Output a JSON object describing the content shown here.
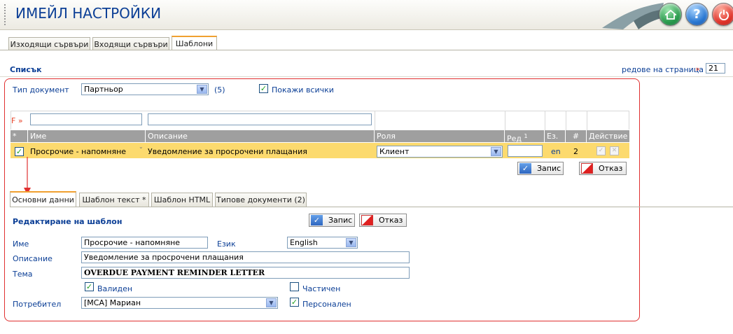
{
  "header": {
    "title": "ИМЕЙЛ НАСТРОЙКИ"
  },
  "top_tabs": [
    "Изходящи сървъри",
    "Входящи сървъри",
    "Шаблони"
  ],
  "list": {
    "title": "Списък",
    "rows_per_page_label": "редове на страница",
    "rows_arrow": "»",
    "rows_per_page": "21"
  },
  "filter": {
    "doc_type_label": "Тип документ",
    "doc_type_value": "Партньор",
    "count": "(5)",
    "show_all_label": "Покажи всички",
    "filter_marker": "F »"
  },
  "grid": {
    "headers": [
      "*",
      "Име",
      "Описание",
      "Роля",
      "Ред",
      "1",
      "Ез.",
      "#",
      "Действие"
    ],
    "row": {
      "name": "Просрочие - напомняне",
      "description": "Уведомление за просрочени плащания",
      "role": "Клиент",
      "order": "",
      "lang": "en",
      "num": "2"
    },
    "save_label": "Запис",
    "cancel_label": "Отказ"
  },
  "sub_tabs": [
    "Основни данни",
    "Шаблон текст *",
    "Шаблон HTML",
    "Типове документи (2)"
  ],
  "edit": {
    "title": "Редактиране на шаблон",
    "save_label": "Запис",
    "cancel_label": "Отказ",
    "name_label": "Име",
    "name_value": "Просрочие - напомняне",
    "lang_label": "Език",
    "lang_value": "English",
    "desc_label": "Описание",
    "desc_value": "Уведомление за просрочени плащания",
    "subject_label": "Тема",
    "subject_value": "OVERDUE PAYMENT REMINDER LETTER",
    "valid_label": "Валиден",
    "partial_label": "Частичен",
    "user_label": "Потребител",
    "user_value": "[MCA] Мариан",
    "personal_label": "Персонален"
  },
  "colors": {
    "accent": "#0c3f96",
    "highlight_row": "#fcda6e",
    "frame": "#e03030",
    "tab_active": "#f0a030"
  }
}
